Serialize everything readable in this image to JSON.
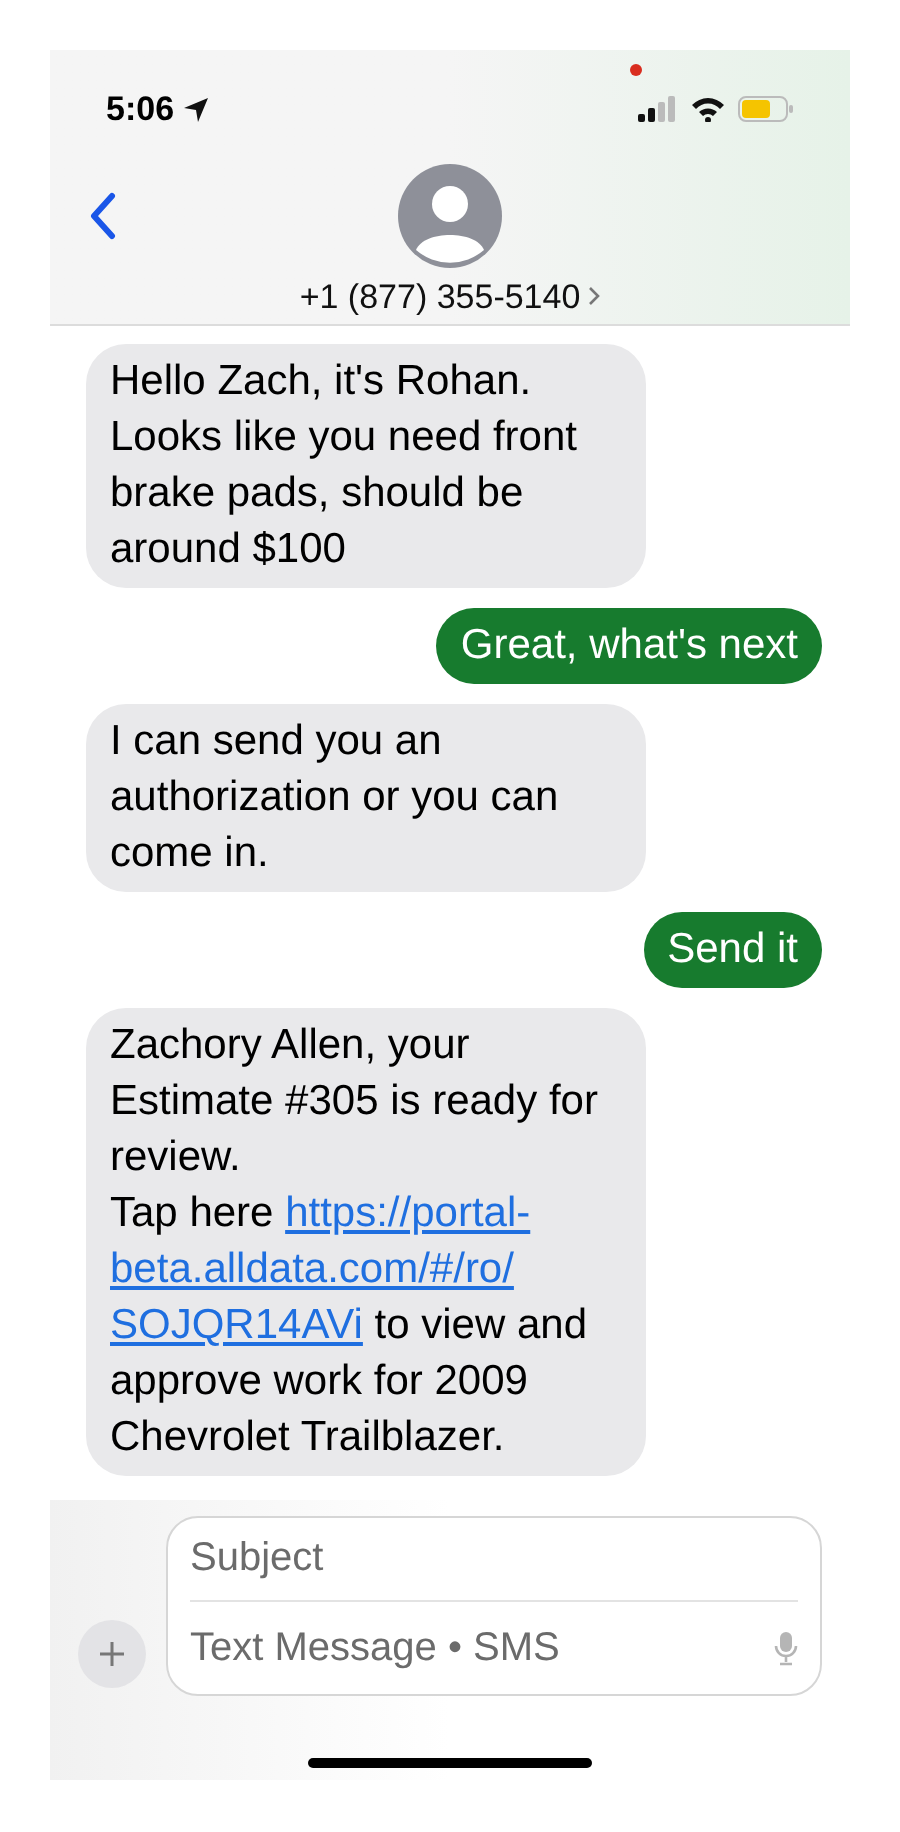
{
  "status_bar": {
    "time": "5:06"
  },
  "header": {
    "contact": "+1 (877) 355-5140"
  },
  "messages": [
    {
      "kind": "incoming",
      "parts": [
        {
          "kind": "text",
          "text": "Hello Zach, it's Rohan. Looks like you need front brake pads, should be around $100"
        }
      ]
    },
    {
      "kind": "outgoing",
      "parts": [
        {
          "kind": "text",
          "text": "Great, what's next"
        }
      ]
    },
    {
      "kind": "incoming",
      "parts": [
        {
          "kind": "text",
          "text": "I can send you an authorization or you can come in."
        }
      ]
    },
    {
      "kind": "outgoing",
      "parts": [
        {
          "kind": "text",
          "text": "Send it"
        }
      ]
    },
    {
      "kind": "incoming",
      "parts": [
        {
          "kind": "text",
          "text": "Zachory Allen, your Estimate #305 is ready for review."
        },
        {
          "kind": "break"
        },
        {
          "kind": "text",
          "text": "Tap here "
        },
        {
          "kind": "link",
          "text": "https://portal-"
        },
        {
          "kind": "break"
        },
        {
          "kind": "link",
          "text": "beta.alldata.com/#/ro/"
        },
        {
          "kind": "break"
        },
        {
          "kind": "link",
          "text": "SOJQR14AVi"
        },
        {
          "kind": "text",
          "text": " to view and approve work for 2009 Chevrolet Trailblazer."
        }
      ]
    }
  ],
  "composer": {
    "subject_placeholder": "Subject",
    "message_placeholder": "Text Message • SMS"
  }
}
